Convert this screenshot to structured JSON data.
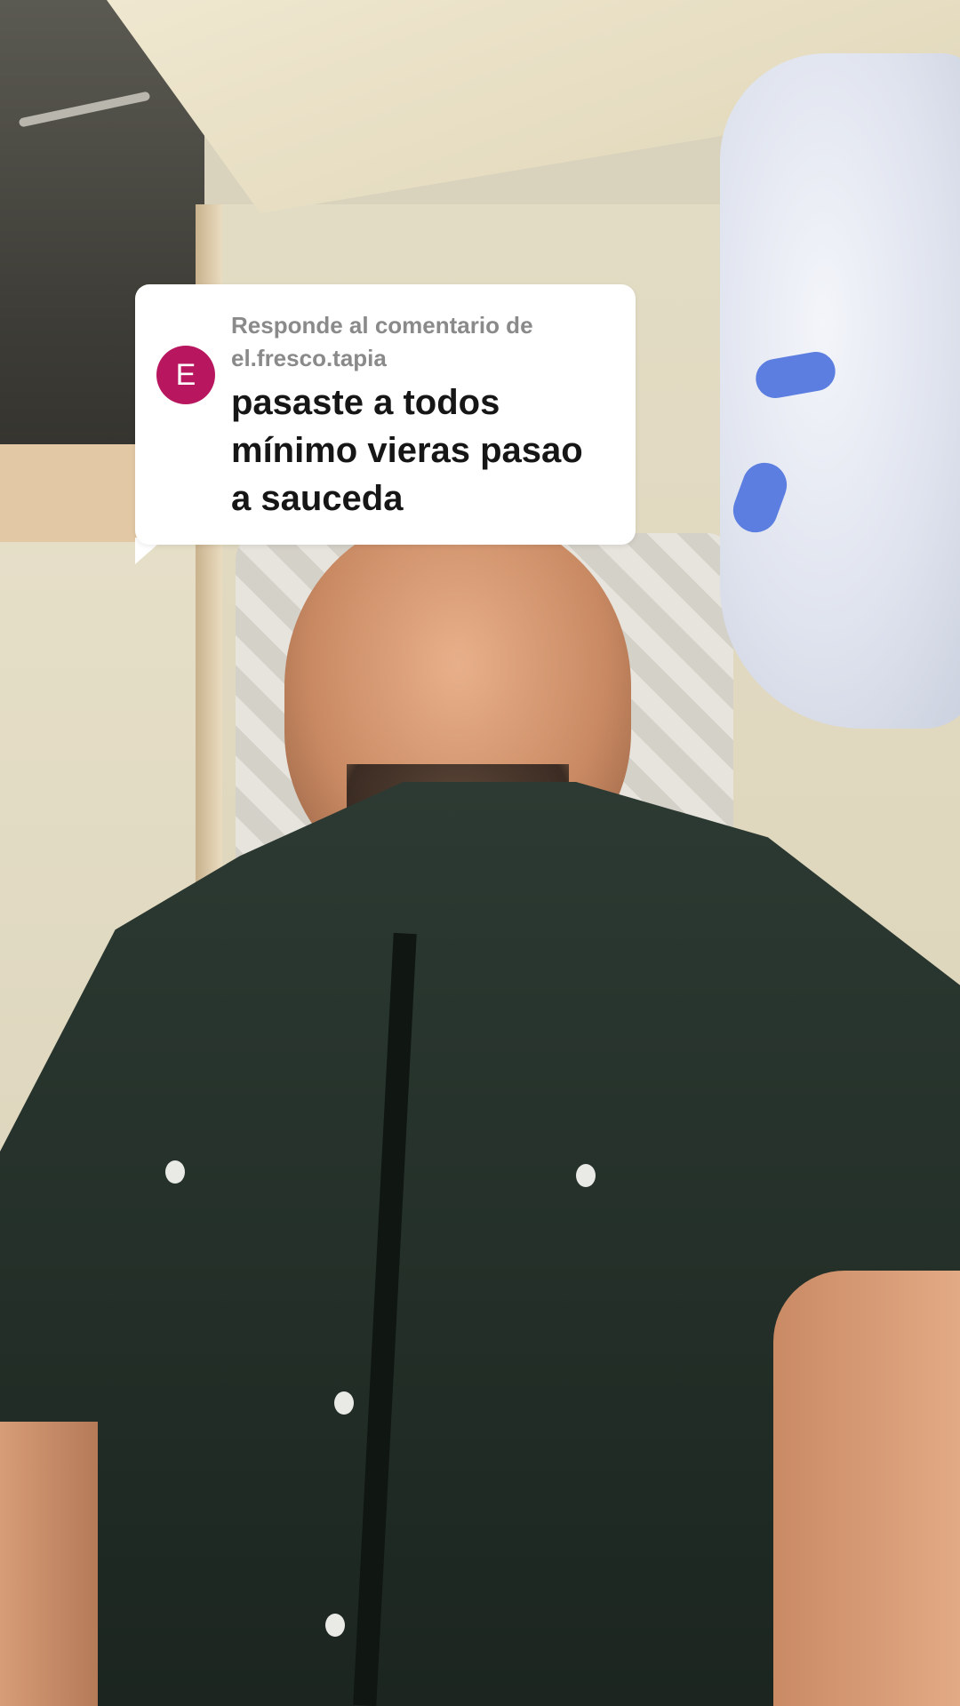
{
  "reply_sticker": {
    "avatar_initial": "E",
    "avatar_color": "#b8175f",
    "header_line1": "Responde al comentario de",
    "header_line2": "el.fresco.tapia",
    "comment_lines": [
      "pasaste a todos",
      "mínimo vieras pasao",
      "a sauceda"
    ]
  },
  "video": {
    "description": ""
  }
}
